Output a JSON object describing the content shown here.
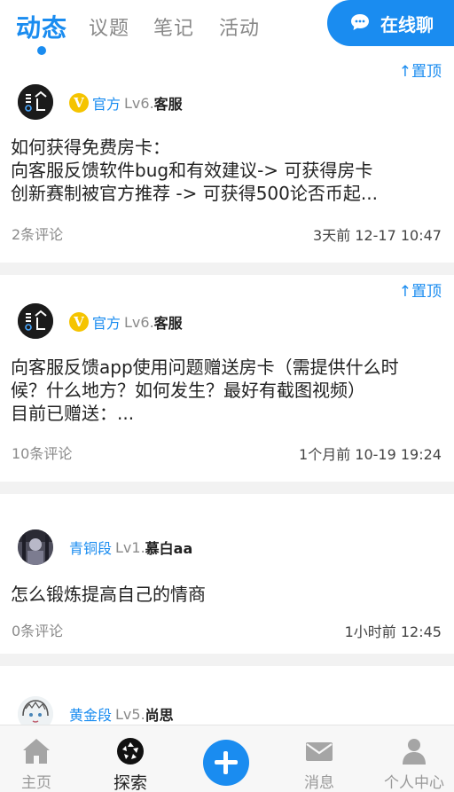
{
  "topbar": {
    "tabs": [
      "动态",
      "议题",
      "笔记",
      "活动"
    ],
    "active_tab": "动态",
    "chat_button": "在线聊"
  },
  "posts": [
    {
      "pinned": true,
      "pin_label": "↑置顶",
      "badge": "V",
      "rank": "官方",
      "level": "Lv6.",
      "author": "客服",
      "lines": [
        "如何获得免费房卡：",
        "向客服反馈软件bug和有效建议-> 可获得房卡",
        "创新赛制被官方推荐 -> 可获得500论否币起..."
      ],
      "comments": "2条评论",
      "time": "3天前 12-17 10:47"
    },
    {
      "pinned": true,
      "pin_label": "↑置顶",
      "badge": "V",
      "rank": "官方",
      "level": "Lv6.",
      "author": "客服",
      "lines": [
        "向客服反馈app使用问题赠送房卡（需提供什么时",
        "候？什么地方？如何发生？最好有截图视频）",
        "目前已赠送：..."
      ],
      "comments": "10条评论",
      "time": "1个月前 10-19 19:24"
    },
    {
      "pinned": false,
      "rank": "青铜段",
      "level": "Lv1.",
      "author": "慕白aa",
      "lines": [
        "怎么锻炼提高自己的情商"
      ],
      "comments": "0条评论",
      "time": "1小时前 12:45"
    },
    {
      "pinned": false,
      "rank": "黄金段",
      "level": "Lv5.",
      "author": "尚思",
      "lines": [],
      "comments": "",
      "time": ""
    }
  ],
  "bottomnav": {
    "items": [
      "主页",
      "探索",
      "消息",
      "个人中心"
    ],
    "active": "探索"
  },
  "colors": {
    "accent": "#1a8cf0",
    "badge": "#f5c400",
    "muted": "#8a8a8a"
  }
}
